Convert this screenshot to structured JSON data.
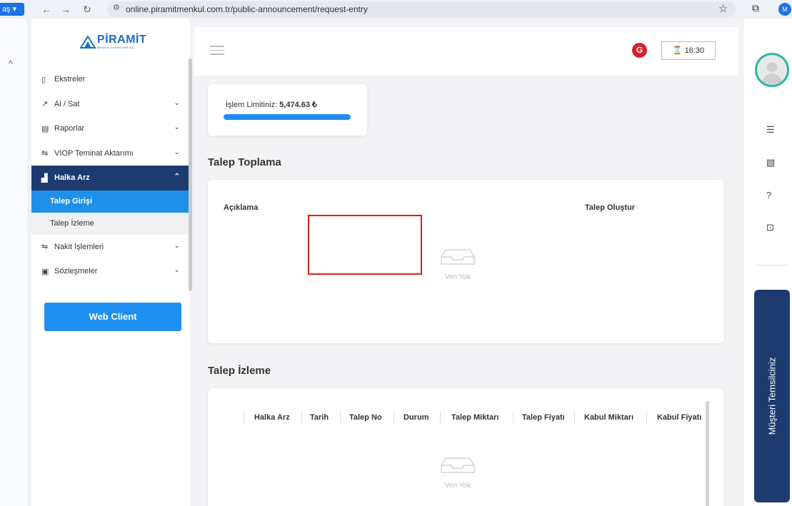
{
  "browser": {
    "tab_stub": "aş ▾",
    "url": "online.piramitmenkul.com.tr/public-announcement/request-entry",
    "profile_initial": "M"
  },
  "sidebar": {
    "logo_title": "PİRAMİT",
    "logo_subtitle": "MENKUL KIYMETLER A.Ş.",
    "items": [
      {
        "label": "Ekstreler",
        "icon": "document-icon",
        "has_chevron": false
      },
      {
        "label": "Al / Sat",
        "icon": "trend-line-icon",
        "has_chevron": true
      },
      {
        "label": "Raporlar",
        "icon": "report-icon",
        "has_chevron": true
      },
      {
        "label": "VİOP Teminat Aktarımı",
        "icon": "transfer-icon",
        "has_chevron": true
      },
      {
        "label": "Halka Arz",
        "icon": "chart-icon",
        "has_chevron": true,
        "active": true
      },
      {
        "label": "Nakit İşlemleri",
        "icon": "exchange-icon",
        "has_chevron": true
      },
      {
        "label": "Sözleşmeler",
        "icon": "contract-icon",
        "has_chevron": true
      }
    ],
    "sub_items": [
      {
        "label": "Talep Girişi",
        "selected": true
      },
      {
        "label": "Talep İzleme",
        "selected": false
      }
    ],
    "web_client_label": "Web Client"
  },
  "header": {
    "timer": "16:30",
    "brand_badge": "G"
  },
  "limit": {
    "label": "İşlem Limitiniz:",
    "value": "5,474.63 ₺",
    "bar_fill_percent": 100
  },
  "request_section": {
    "title": "Talep Toplama",
    "col_description": "Açıklama",
    "col_create": "Talep Oluştur",
    "empty_text": "Veri Yok"
  },
  "monitor_section": {
    "title": "Talep İzleme",
    "columns": [
      "Halka Arz",
      "Tarih",
      "Talep No",
      "Durum",
      "Talep Miktarı",
      "Talep Fiyatı",
      "Kabul Miktarı",
      "Kabul Fiyatı"
    ],
    "empty_text": "Veri Yok"
  },
  "right_panel": {
    "representative_label": "Müşteri Temsilciniz"
  },
  "colors": {
    "navy": "#1d3b6e",
    "blue": "#1e8ff0",
    "highlight_red": "#e01b1b",
    "teal": "#2bb8a8"
  }
}
